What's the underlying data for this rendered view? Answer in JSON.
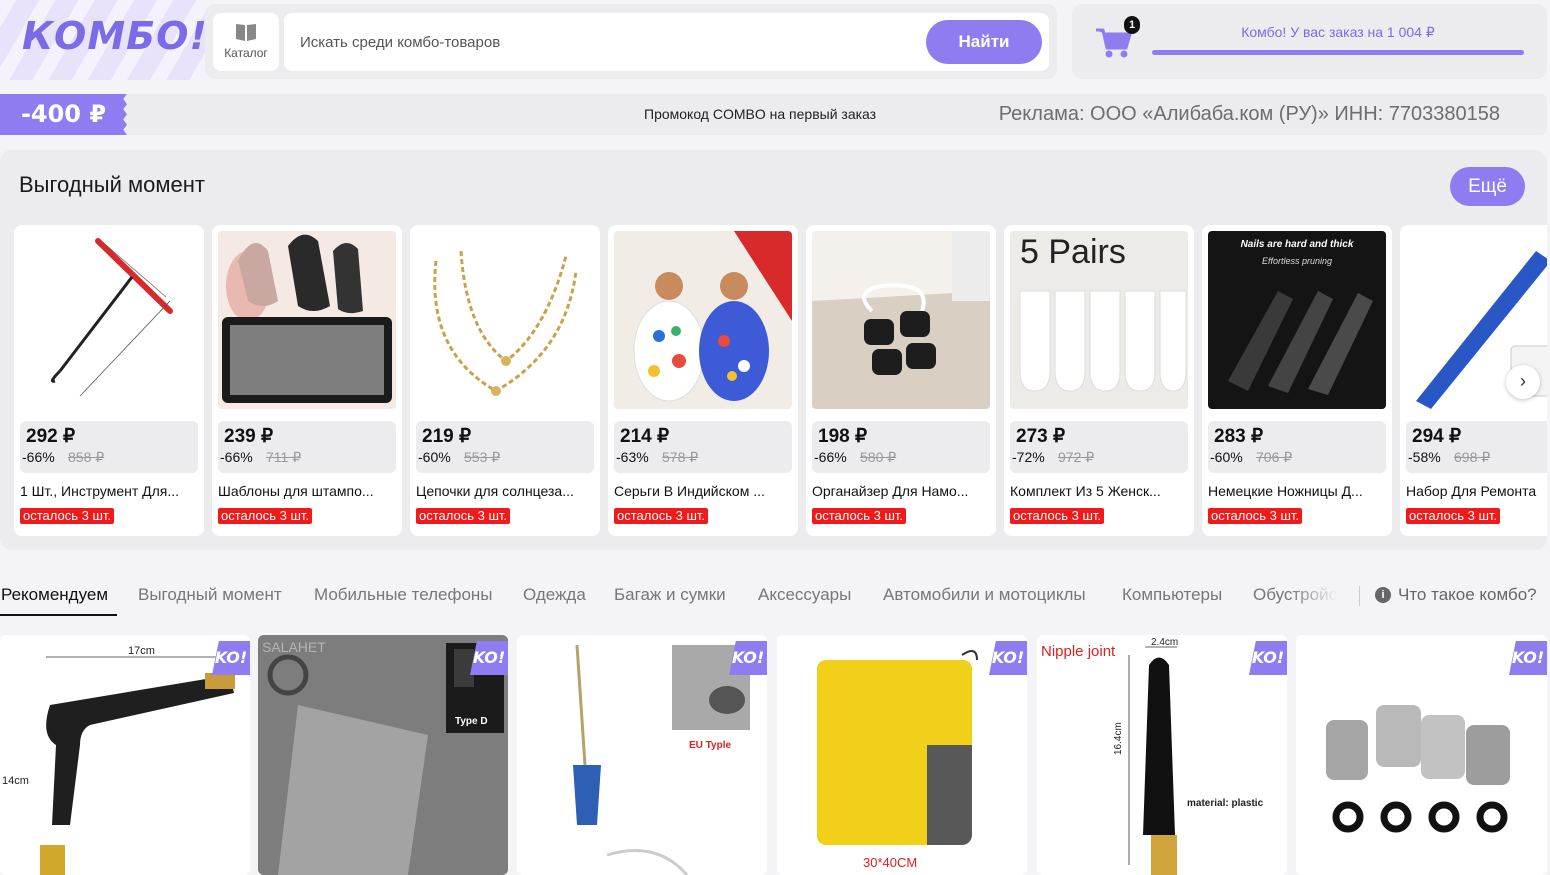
{
  "header": {
    "logo": "КОМБО!",
    "catalog_label": "Каталог",
    "search_placeholder": "Искать среди комбо-товаров",
    "search_button": "Найти",
    "cart_count": "1",
    "cart_message": "Комбо! У вас заказ на 1 004 ₽"
  },
  "promo": {
    "amount": "-400 ₽",
    "text": "Промокод COMBO на первый заказ",
    "ad": "Реклама: ООО «Алибаба.ком (РУ)» ИНН: 7703380158"
  },
  "deals": {
    "title": "Выгодный момент",
    "more": "Ещё",
    "items": [
      {
        "price": "292 ₽",
        "discount": "-66%",
        "old_price": "858 ₽",
        "name": "1 Шт., Инструмент Для...",
        "stock": "осталось 3 шт."
      },
      {
        "price": "239 ₽",
        "discount": "-66%",
        "old_price": "711 ₽",
        "name": "Шаблоны для штампо...",
        "stock": "осталось 3 шт."
      },
      {
        "price": "219 ₽",
        "discount": "-60%",
        "old_price": "553 ₽",
        "name": "Цепочки для солнцеза...",
        "stock": "осталось 3 шт."
      },
      {
        "price": "214 ₽",
        "discount": "-63%",
        "old_price": "578 ₽",
        "name": "Серьги В Индийском ...",
        "stock": "осталось 3 шт."
      },
      {
        "price": "198 ₽",
        "discount": "-66%",
        "old_price": "580 ₽",
        "name": "Органайзер Для Намо...",
        "stock": "осталось 3 шт."
      },
      {
        "price": "273 ₽",
        "discount": "-72%",
        "old_price": "972 ₽",
        "name": "Комплект Из 5 Женск...",
        "stock": "осталось 3 шт."
      },
      {
        "price": "283 ₽",
        "discount": "-60%",
        "old_price": "706 ₽",
        "name": "Немецкие Ножницы Д...",
        "stock": "осталось 3 шт."
      },
      {
        "price": "294 ₽",
        "discount": "-58%",
        "old_price": "698 ₽",
        "name": "Набор Для Ремонта",
        "stock": "осталось 3 шт."
      }
    ],
    "image_texts": {
      "socks": "5 Pairs",
      "nails_line1": "Nails are hard and thick",
      "nails_line2": "Effortless pruning"
    }
  },
  "tabs": {
    "items": [
      "Рекомендуем",
      "Выгодный момент",
      "Мобильные телефоны",
      "Одежда",
      "Багаж и сумки",
      "Аксессуары",
      "Автомобили и мотоциклы",
      "Компьютеры",
      "Обустройс"
    ],
    "info": "Что такое комбо?"
  },
  "products": {
    "badge": "KO!",
    "gun_dim_top": "17cm",
    "gun_dim_side": "14cm",
    "card_type": "Type D",
    "card_brand": "SALAHET",
    "eu_type": "EU Typle",
    "towel_size": "30*40CM",
    "nipple": "Nipple joint",
    "nipple_dim_top": "2.4cm",
    "nipple_dim_side": "16.4cm",
    "nipple_material": "material: plastic"
  },
  "colors": {
    "accent": "#8e7cf0",
    "stock_red": "#f01a1a"
  }
}
